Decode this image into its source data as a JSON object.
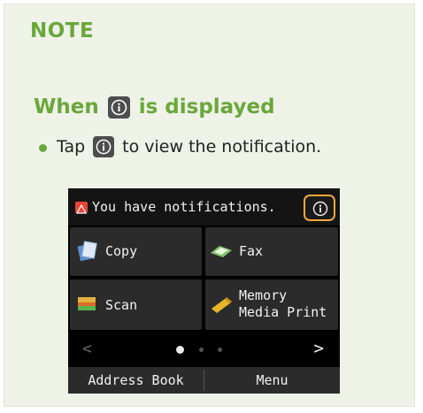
{
  "note": {
    "title": "NOTE",
    "subhead_before": "When",
    "subhead_after": "is displayed",
    "bullet_before": "Tap",
    "bullet_after": "to view the notification."
  },
  "device": {
    "status_text": "You have notifications.",
    "tiles": [
      {
        "label": "Copy",
        "icon": "copy-icon"
      },
      {
        "label": "Fax",
        "icon": "fax-icon"
      },
      {
        "label": "Scan",
        "icon": "scan-icon"
      },
      {
        "label_line1": "Memory",
        "label_line2": "Media Print",
        "icon": "memory-media-icon"
      }
    ],
    "prev_arrow": "<",
    "next_arrow": ">",
    "page_count": 3,
    "current_page": 1,
    "bottom_left": "Address Book",
    "bottom_right": "Menu"
  },
  "colors": {
    "accent": "#6aa73b",
    "note_bg": "#eef2e7",
    "highlight": "#f0a83c",
    "warning": "#e8443a"
  }
}
